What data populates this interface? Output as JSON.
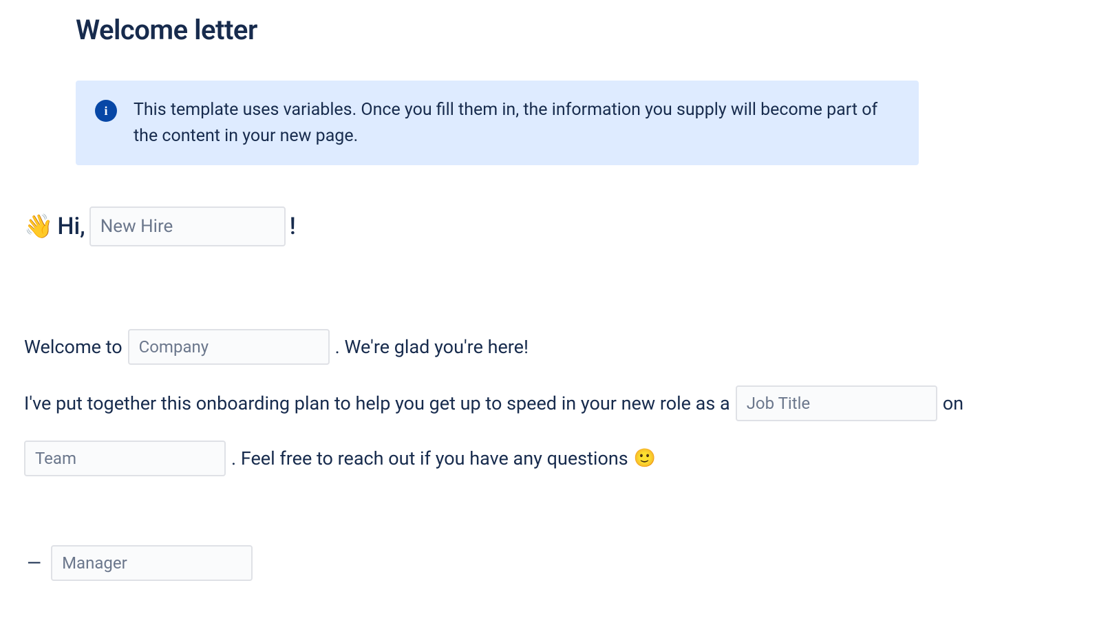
{
  "title": "Welcome letter",
  "info": {
    "text": "This template uses variables. Once you fill them in, the information you supply will become part of the content in your new page."
  },
  "greeting": {
    "wave_emoji": "👋",
    "hi": "Hi,",
    "exclaim": "!"
  },
  "vars": {
    "new_hire_placeholder": "New Hire",
    "company_placeholder": "Company",
    "job_title_placeholder": "Job Title",
    "team_placeholder": "Team",
    "manager_placeholder": "Manager"
  },
  "body": {
    "welcome_to": "Welcome to",
    "glad_here": ". We're glad you're here!",
    "plan_intro": "I've put together this onboarding plan to help you get up to speed in your new role as a",
    "on": "on",
    "reach_out": ". Feel free to reach out if you have any questions",
    "smile_emoji": "🙂",
    "dash": "—"
  }
}
